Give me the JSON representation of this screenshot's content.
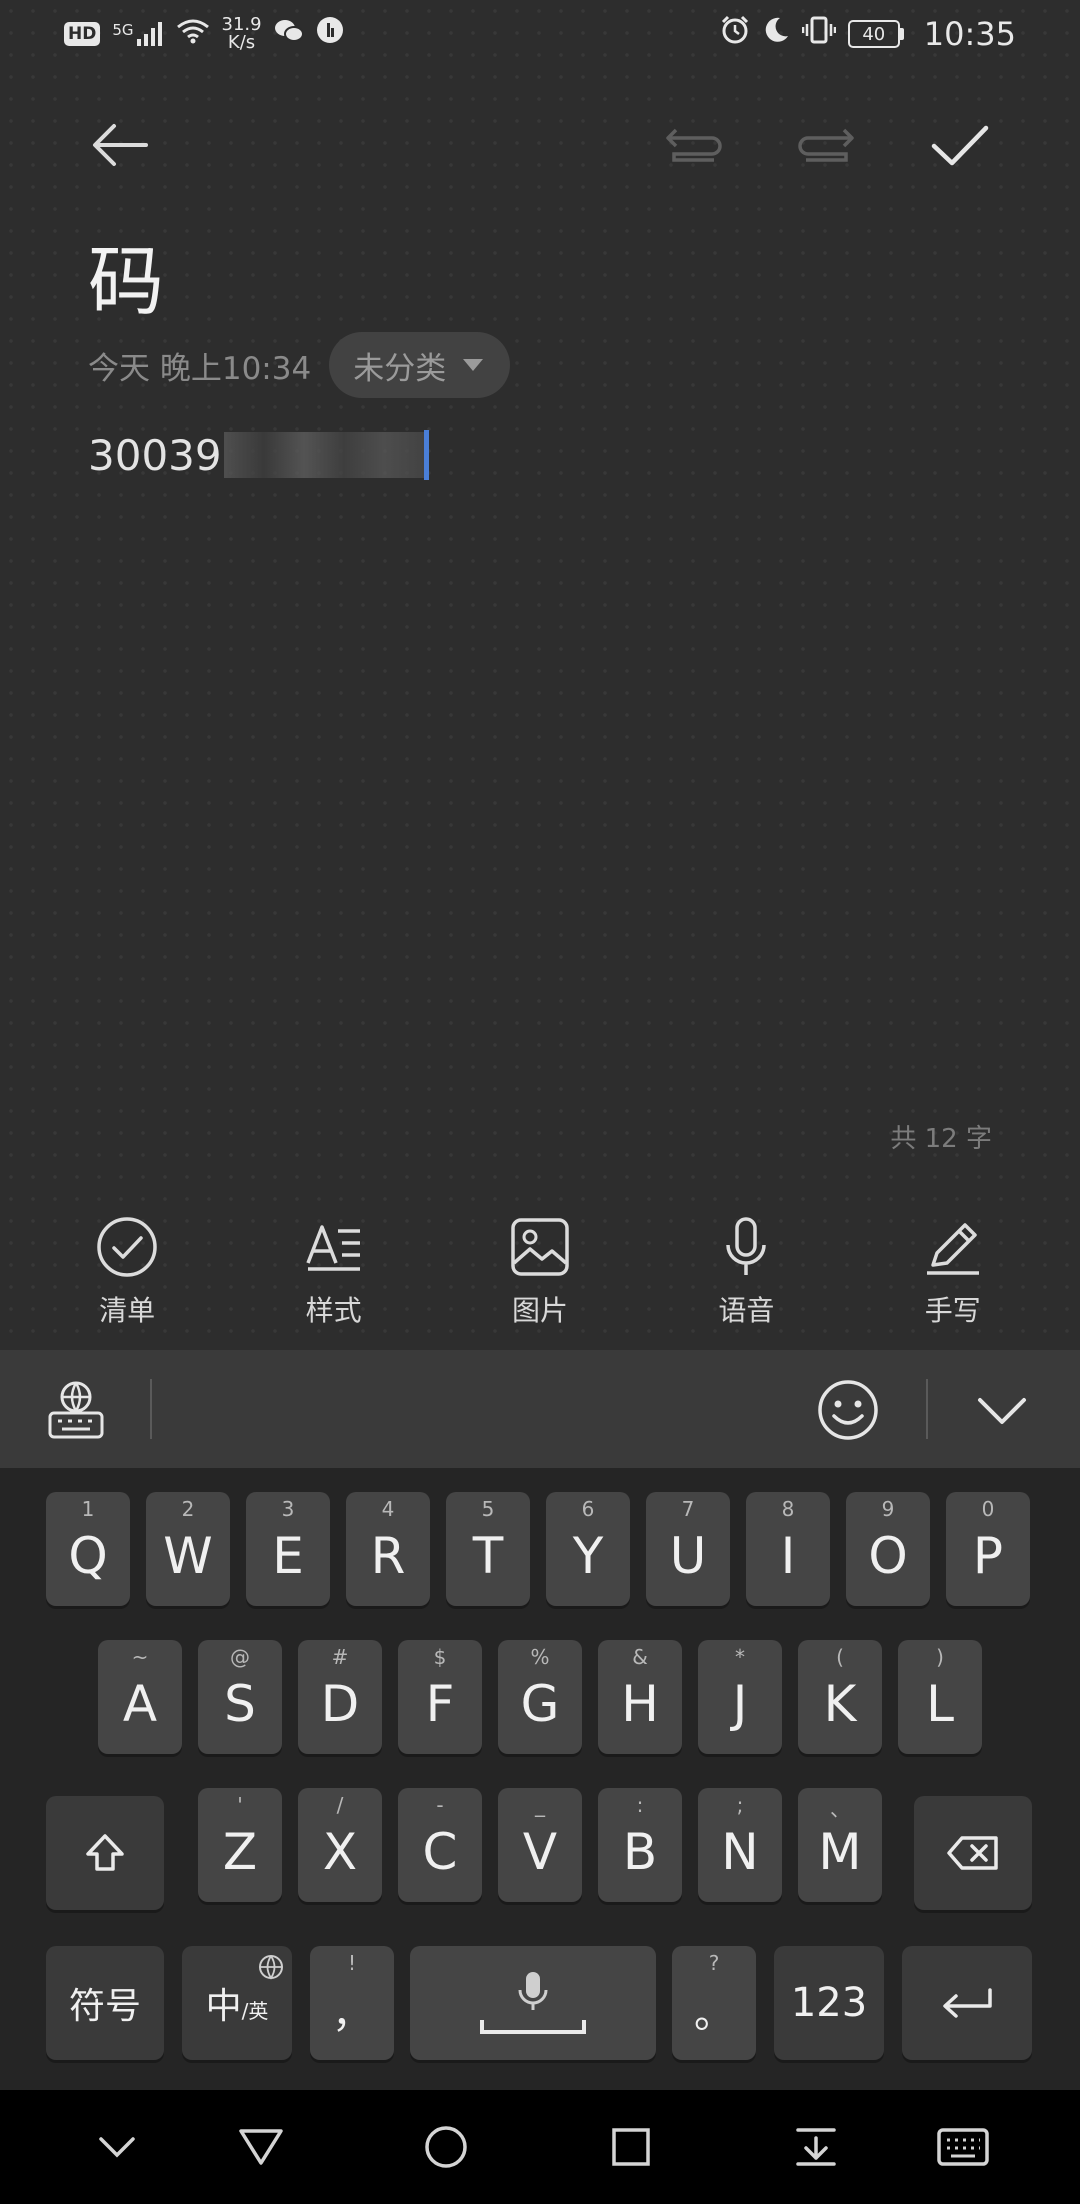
{
  "status_bar": {
    "hd": "HD",
    "signal_label": "5G",
    "net_speed_value": "31.9",
    "net_speed_unit": "K/s",
    "battery_level": "40",
    "time": "10:35"
  },
  "note": {
    "title": "码",
    "date": "今天 晚上10:34",
    "category": "未分类",
    "body_visible": "30039",
    "word_count": "共 12 字"
  },
  "tools": [
    {
      "label": "清单",
      "icon": "checklist-icon"
    },
    {
      "label": "样式",
      "icon": "text-style-icon"
    },
    {
      "label": "图片",
      "icon": "image-icon"
    },
    {
      "label": "语音",
      "icon": "microphone-icon"
    },
    {
      "label": "手写",
      "icon": "handwriting-pen-icon"
    }
  ],
  "keyboard": {
    "row1": [
      {
        "main": "Q",
        "sub": "1"
      },
      {
        "main": "W",
        "sub": "2"
      },
      {
        "main": "E",
        "sub": "3"
      },
      {
        "main": "R",
        "sub": "4"
      },
      {
        "main": "T",
        "sub": "5"
      },
      {
        "main": "Y",
        "sub": "6"
      },
      {
        "main": "U",
        "sub": "7"
      },
      {
        "main": "I",
        "sub": "8"
      },
      {
        "main": "O",
        "sub": "9"
      },
      {
        "main": "P",
        "sub": "0"
      }
    ],
    "row2": [
      {
        "main": "A",
        "sub": "~"
      },
      {
        "main": "S",
        "sub": "@"
      },
      {
        "main": "D",
        "sub": "#"
      },
      {
        "main": "F",
        "sub": "$"
      },
      {
        "main": "G",
        "sub": "%"
      },
      {
        "main": "H",
        "sub": "&"
      },
      {
        "main": "J",
        "sub": "*"
      },
      {
        "main": "K",
        "sub": "("
      },
      {
        "main": "L",
        "sub": ")"
      }
    ],
    "row3": [
      {
        "main": "Z",
        "sub": "'"
      },
      {
        "main": "X",
        "sub": "/"
      },
      {
        "main": "C",
        "sub": "-"
      },
      {
        "main": "V",
        "sub": "_"
      },
      {
        "main": "B",
        "sub": ":"
      },
      {
        "main": "N",
        "sub": ";"
      },
      {
        "main": "M",
        "sub": "、"
      }
    ],
    "symbols_label": "符号",
    "lang_main": "中",
    "lang_sub": "/英",
    "comma_main": "，",
    "comma_sub": "!",
    "period_main": "。",
    "period_sub": "?",
    "numbers_label": "123"
  }
}
